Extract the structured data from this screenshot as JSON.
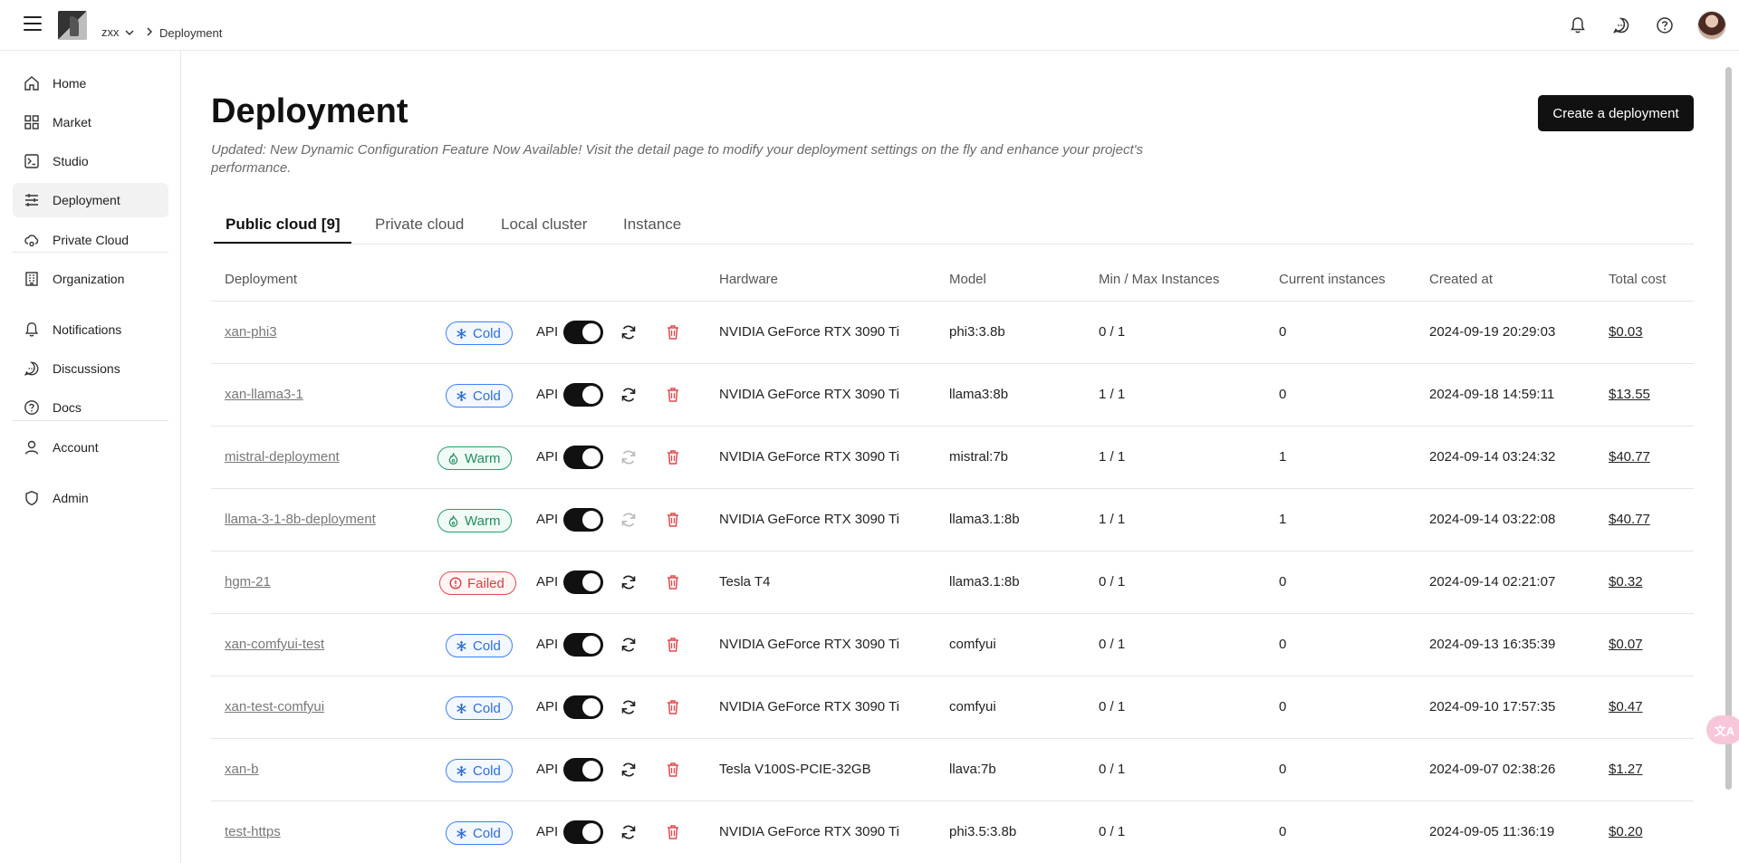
{
  "header": {
    "workspace": "zxx",
    "breadcrumb": "Deployment",
    "icons": [
      "bell-icon",
      "chat-icon",
      "help-icon",
      "avatar"
    ]
  },
  "sidebar": {
    "items": [
      {
        "label": "Home",
        "icon": "home-icon"
      },
      {
        "label": "Market",
        "icon": "grid-icon"
      },
      {
        "label": "Studio",
        "icon": "terminal-icon"
      },
      {
        "label": "Deployment",
        "icon": "sliders-icon",
        "active": true
      },
      {
        "label": "Private Cloud",
        "icon": "cloud-icon"
      },
      {
        "label": "Organization",
        "icon": "building-icon"
      },
      {
        "label": "Notifications",
        "icon": "bell-icon"
      },
      {
        "label": "Discussions",
        "icon": "chat-icon"
      },
      {
        "label": "Docs",
        "icon": "help-icon"
      },
      {
        "label": "Account",
        "icon": "user-icon"
      },
      {
        "label": "Admin",
        "icon": "shield-icon"
      }
    ]
  },
  "main": {
    "title": "Deployment",
    "create_button": "Create a deployment",
    "notice": "Updated: New Dynamic Configuration Feature Now Available! Visit the detail page to modify your deployment settings on the fly and enhance your project's performance.",
    "tabs": [
      {
        "label": "Public cloud [9]",
        "active": true
      },
      {
        "label": "Private cloud"
      },
      {
        "label": "Local cluster"
      },
      {
        "label": "Instance"
      }
    ],
    "columns": {
      "deployment": "Deployment",
      "hardware": "Hardware",
      "model": "Model",
      "instances": "Min / Max Instances",
      "current": "Current instances",
      "created": "Created at",
      "cost": "Total cost"
    },
    "api_label": "API",
    "rows": [
      {
        "name": "xan-phi3",
        "status": "Cold",
        "hardware": "NVIDIA GeForce RTX 3090 Ti",
        "model": "phi3:3.8b",
        "minmax": "0 / 1",
        "current": "0",
        "created": "2024-09-19 20:29:03",
        "cost": "$0.03"
      },
      {
        "name": "xan-llama3-1",
        "status": "Cold",
        "hardware": "NVIDIA GeForce RTX 3090 Ti",
        "model": "llama3:8b",
        "minmax": "1 / 1",
        "current": "0",
        "created": "2024-09-18 14:59:11",
        "cost": "$13.55"
      },
      {
        "name": "mistral-deployment",
        "status": "Warm",
        "hardware": "NVIDIA GeForce RTX 3090 Ti",
        "model": "mistral:7b",
        "minmax": "1 / 1",
        "current": "1",
        "created": "2024-09-14 03:24:32",
        "cost": "$40.77"
      },
      {
        "name": "llama-3-1-8b-deployment",
        "status": "Warm",
        "hardware": "NVIDIA GeForce RTX 3090 Ti",
        "model": "llama3.1:8b",
        "minmax": "1 / 1",
        "current": "1",
        "created": "2024-09-14 03:22:08",
        "cost": "$40.77"
      },
      {
        "name": "hgm-21",
        "status": "Failed",
        "hardware": "Tesla T4",
        "model": "llama3.1:8b",
        "minmax": "0 / 1",
        "current": "0",
        "created": "2024-09-14 02:21:07",
        "cost": "$0.32"
      },
      {
        "name": "xan-comfyui-test",
        "status": "Cold",
        "hardware": "NVIDIA GeForce RTX 3090 Ti",
        "model": "comfyui",
        "minmax": "0 / 1",
        "current": "0",
        "created": "2024-09-13 16:35:39",
        "cost": "$0.07"
      },
      {
        "name": "xan-test-comfyui",
        "status": "Cold",
        "hardware": "NVIDIA GeForce RTX 3090 Ti",
        "model": "comfyui",
        "minmax": "0 / 1",
        "current": "0",
        "created": "2024-09-10 17:57:35",
        "cost": "$0.47"
      },
      {
        "name": "xan-b",
        "status": "Cold",
        "hardware": "Tesla V100S-PCIE-32GB",
        "model": "llava:7b",
        "minmax": "0 / 1",
        "current": "0",
        "created": "2024-09-07 02:38:26",
        "cost": "$1.27"
      },
      {
        "name": "test-https",
        "status": "Cold",
        "hardware": "NVIDIA GeForce RTX 3090 Ti",
        "model": "phi3.5:3.8b",
        "minmax": "0 / 1",
        "current": "0",
        "created": "2024-09-05 11:36:19",
        "cost": "$0.20"
      }
    ]
  },
  "translate_button": "文A",
  "colors": {
    "cold": "#3b82f6",
    "warm": "#22a06b",
    "failed": "#e5484d",
    "primary": "#111111"
  }
}
